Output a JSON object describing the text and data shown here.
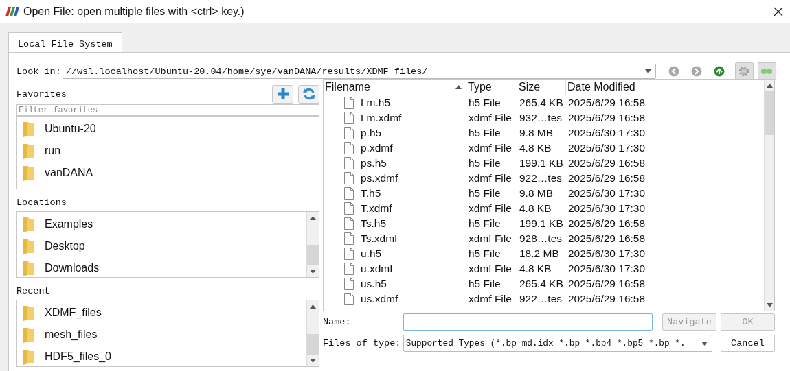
{
  "window": {
    "title": "Open File:  open multiple files with <ctrl> key.)"
  },
  "tabs": [
    {
      "label": "Local File System",
      "selected": true
    }
  ],
  "look_in": {
    "label": "Look in:",
    "value": "//wsl.localhost/Ubuntu-20.04/home/sye/vanDANA/results/XDMF_files/"
  },
  "nav_buttons": [
    {
      "kind": "back",
      "disabled": true
    },
    {
      "kind": "forward",
      "disabled": true
    },
    {
      "kind": "up",
      "disabled": false
    }
  ],
  "toggle_buttons": [
    {
      "kind": "settings",
      "checked": true
    },
    {
      "kind": "dots",
      "checked": true
    }
  ],
  "favorites": {
    "label": "Favorites",
    "filter_placeholder": "Filter favorites",
    "items": [
      "Ubuntu-20",
      "run",
      "vanDANA"
    ]
  },
  "locations": {
    "label": "Locations",
    "items": [
      "Examples",
      "Desktop",
      "Downloads"
    ]
  },
  "recent": {
    "label": "Recent",
    "items": [
      "XDMF_files",
      "mesh_files",
      "HDF5_files_0"
    ]
  },
  "table": {
    "columns": [
      "Filename",
      "Type",
      "Size",
      "Date Modified"
    ],
    "rows": [
      [
        "Lm.h5",
        "h5 File",
        "265.4 KB",
        "2025/6/29 16:58"
      ],
      [
        "Lm.xdmf",
        "xdmf File",
        "932…tes",
        "2025/6/29 16:58"
      ],
      [
        "p.h5",
        "h5 File",
        "9.8 MB",
        "2025/6/30 17:30"
      ],
      [
        "p.xdmf",
        "xdmf File",
        "4.8 KB",
        "2025/6/30 17:30"
      ],
      [
        "ps.h5",
        "h5 File",
        "199.1 KB",
        "2025/6/29 16:58"
      ],
      [
        "ps.xdmf",
        "xdmf File",
        "922…tes",
        "2025/6/29 16:58"
      ],
      [
        "T.h5",
        "h5 File",
        "9.8 MB",
        "2025/6/30 17:30"
      ],
      [
        "T.xdmf",
        "xdmf File",
        "4.8 KB",
        "2025/6/30 17:30"
      ],
      [
        "Ts.h5",
        "h5 File",
        "199.1 KB",
        "2025/6/29 16:58"
      ],
      [
        "Ts.xdmf",
        "xdmf File",
        "928…tes",
        "2025/6/29 16:58"
      ],
      [
        "u.h5",
        "h5 File",
        "18.2 MB",
        "2025/6/30 17:30"
      ],
      [
        "u.xdmf",
        "xdmf File",
        "4.8 KB",
        "2025/6/30 17:30"
      ],
      [
        "us.h5",
        "h5 File",
        "265.4 KB",
        "2025/6/29 16:58"
      ],
      [
        "us.xdmf",
        "xdmf File",
        "922…tes",
        "2025/6/29 16:58"
      ]
    ]
  },
  "name": {
    "label": "Name:"
  },
  "files_of_type": {
    "label": "Files of type:",
    "value": "Supported Types (*.bp md.idx *.bp *.bp4 *.bp5 *.bp *."
  },
  "buttons": [
    {
      "label": "Navigate",
      "disabled": true
    },
    {
      "label": "OK",
      "disabled": true
    },
    {
      "label": "Cancel",
      "disabled": false
    }
  ]
}
